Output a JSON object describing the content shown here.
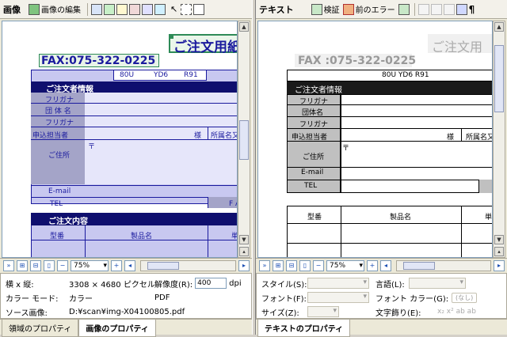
{
  "left": {
    "title": "画像",
    "toolbar": {
      "edit_image": "画像の編集"
    },
    "doc": {
      "title": "ご注文用紙",
      "fax": "FAX:075-322-0225",
      "codes": [
        "80U",
        "YD6",
        "R91"
      ],
      "section1": "ご注文者情報",
      "rows": [
        "フリガナ",
        "団 体 名",
        "フリガナ",
        "申込担当者",
        "ご住所",
        "E-mail",
        "TEL"
      ],
      "sama": "様",
      "dept": "所属名又",
      "postal": "〒",
      "fax_short": "F A",
      "section2": "ご注文内容",
      "cols": [
        "型番",
        "製品名",
        "単"
      ]
    },
    "zoom": "75%",
    "props": {
      "size_label": "横 x 縦:",
      "size_value": "3308 × 4680 ピクセル",
      "res_label": "解像度(R):",
      "res_value": "400",
      "res_unit": "dpi",
      "mode_label": "カラー モード:",
      "mode_value": "カラー",
      "format_value": "PDF",
      "source_label": "ソース画像:",
      "source_value": "D:¥scan¥img-X04100805.pdf"
    },
    "tabs": [
      "領域のプロパティ",
      "画像のプロパティ"
    ]
  },
  "right": {
    "title": "テキスト",
    "toolbar": {
      "verify": "検証",
      "prev_error": "前のエラー"
    },
    "doc": {
      "title": "ご注文用",
      "fax": "FAX :075-322-0225",
      "codes": "80U YD6 R91",
      "section1": "ご注文者情報",
      "rows": [
        "フリガナ",
        "団体名",
        "フリガナ",
        "申込担当者",
        "ご住所",
        "E-mail",
        "TEL"
      ],
      "sama": "様",
      "dept": "所属名又",
      "postal": "〒",
      "cols": [
        "型番",
        "製品名",
        "単"
      ]
    },
    "zoom": "75%",
    "props": {
      "style_label": "スタイル(S):",
      "lang_label": "言語(L):",
      "font_label": "フォント(F):",
      "fontcolor_label": "フォント カラー(G):",
      "fontcolor_value": "(なし)",
      "size_label": "サイズ(Z):",
      "deco_label": "文字飾り(E):",
      "deco_glyphs": "x₂ x² ab ab"
    },
    "tabs": [
      "テキストのプロパティ"
    ]
  },
  "colors": {
    "accent": "#1a1a9e",
    "grid_fill": "#c8c8f0",
    "row_fill": "#a4a4c8",
    "selection": "#2e8b57"
  }
}
